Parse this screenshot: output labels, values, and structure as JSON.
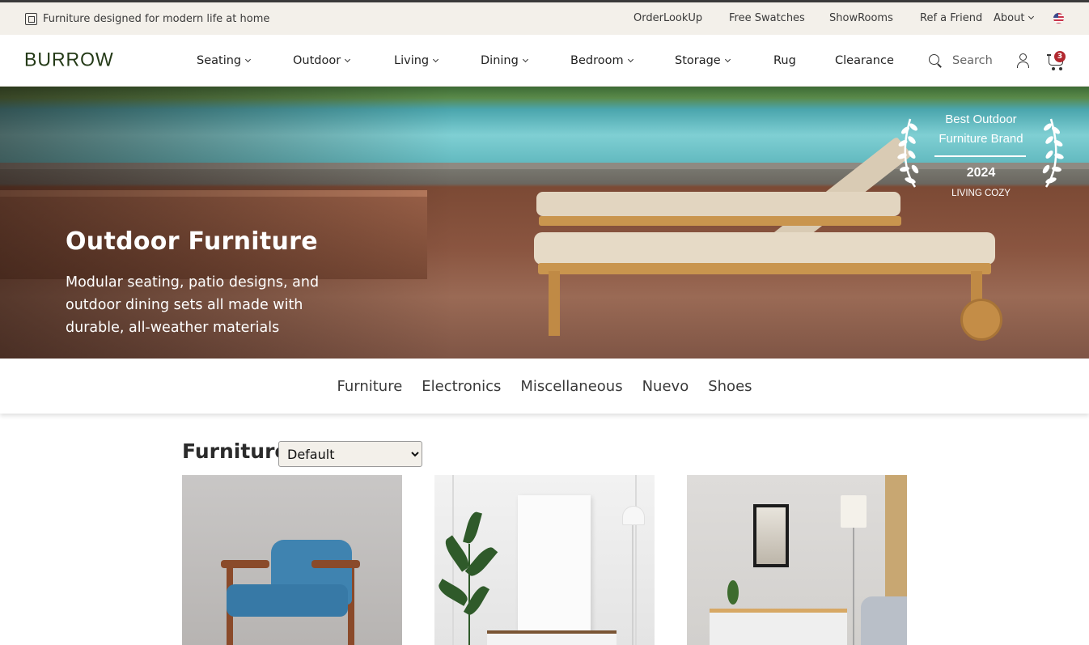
{
  "utility_bar": {
    "tagline": "Furniture designed for modern life at home",
    "links": [
      "OrderLookUp",
      "Free Swatches",
      "ShowRooms",
      "Ref a Friend",
      "About"
    ]
  },
  "header": {
    "logo": "BURROW",
    "nav": [
      "Seating",
      "Outdoor",
      "Living",
      "Dining",
      "Bedroom",
      "Storage",
      "Rug",
      "Clearance"
    ],
    "search_placeholder": "Search",
    "cart_count": "3"
  },
  "hero": {
    "title": "Outdoor Furniture",
    "subtitle": "Modular seating, patio designs, and outdoor dining sets all made with durable, all-weather materials",
    "award": {
      "line1": "Best Outdoor",
      "line2": "Furniture Brand",
      "year": "2024",
      "org": "LIVING COZY"
    }
  },
  "categories": [
    "Furniture",
    "Electronics",
    "Miscellaneous",
    "Nuevo",
    "Shoes"
  ],
  "section": {
    "title": "Furniture",
    "sort_selected": "Default"
  },
  "icons": {
    "tagline": "square-icon",
    "search": "search-icon",
    "account": "user-icon",
    "cart": "cart-icon",
    "locale": "us-flag-icon"
  },
  "colors": {
    "utility_bg": "#f3f0ea",
    "logo": "#243a17",
    "cart_badge": "#b2282f"
  }
}
